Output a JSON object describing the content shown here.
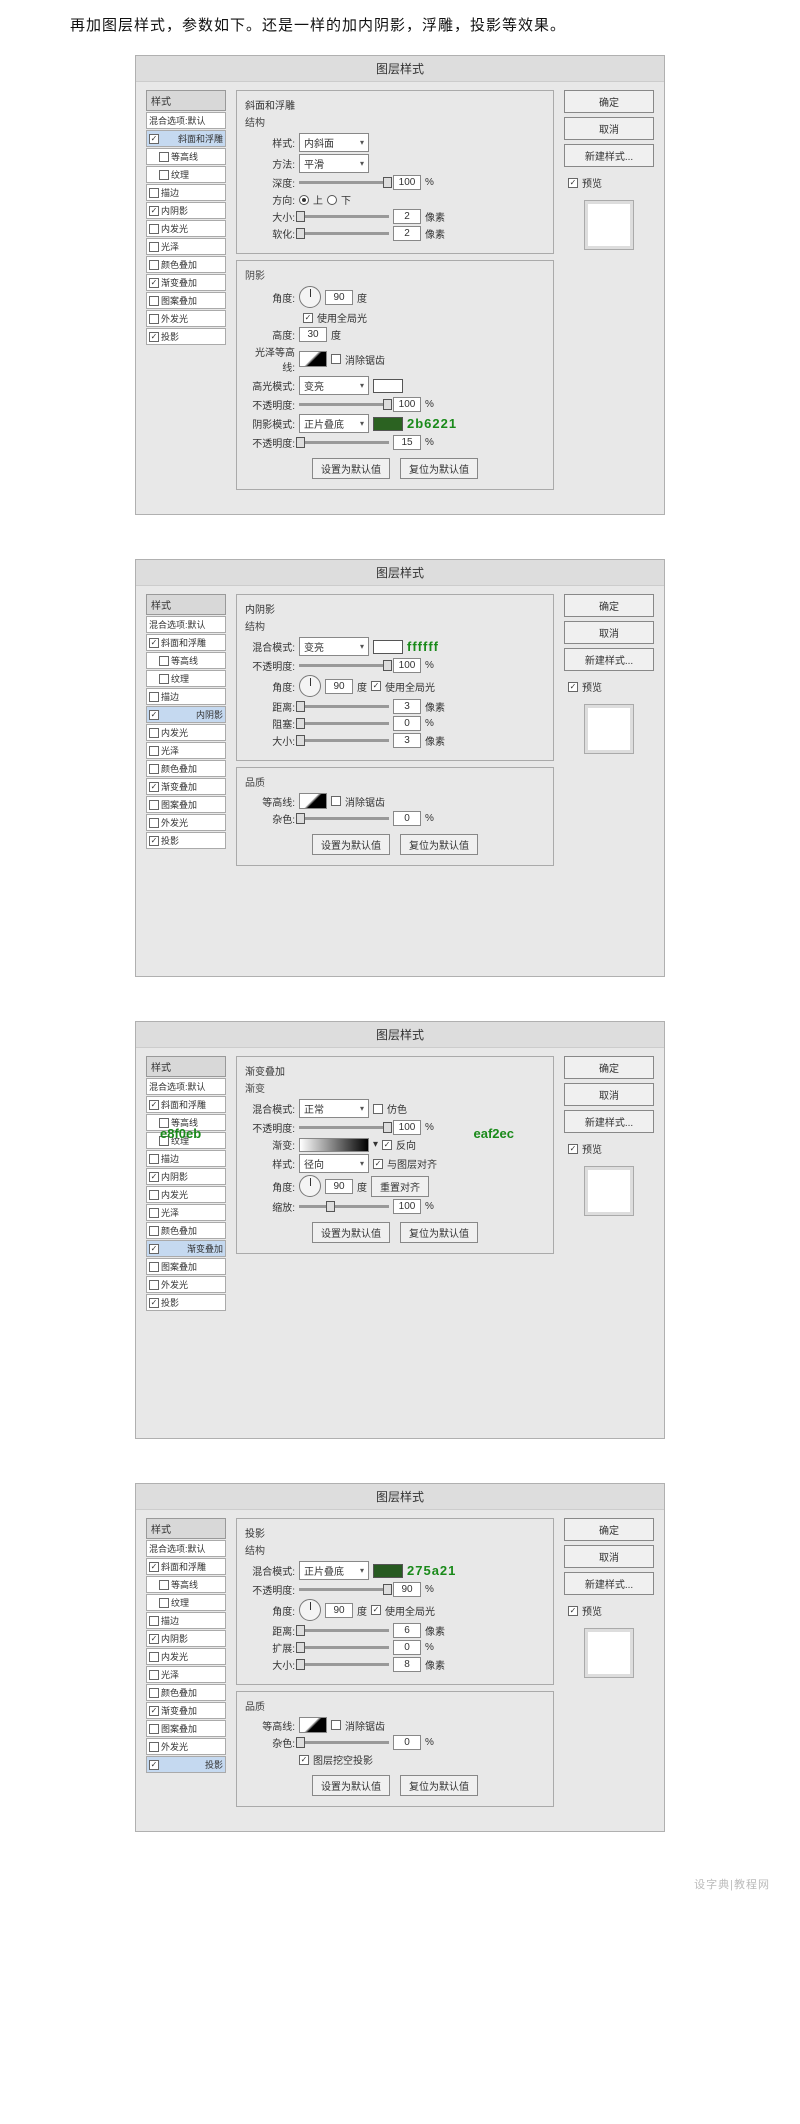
{
  "intro_text": "再加图层样式，参数如下。还是一样的加内阴影，浮雕，投影等效果。",
  "common": {
    "dialog_title": "图层样式",
    "ok": "确定",
    "cancel": "取消",
    "new_style": "新建样式...",
    "preview": "预览",
    "set_default": "设置为默认值",
    "reset_default": "复位为默认值",
    "styles_header": "样式",
    "blend_default": "混合选项:默认"
  },
  "style_names": {
    "bevel": "斜面和浮雕",
    "contour": "等高线",
    "texture": "纹理",
    "stroke": "描边",
    "inner_shadow": "内阴影",
    "inner_glow": "内发光",
    "satin": "光泽",
    "color_overlay": "颜色叠加",
    "gradient_overlay": "渐变叠加",
    "pattern_overlay": "图案叠加",
    "outer_glow": "外发光",
    "drop_shadow": "投影"
  },
  "panel1": {
    "title": "斜面和浮雕",
    "struct": "结构",
    "style_lbl": "样式:",
    "style_val": "内斜面",
    "method_lbl": "方法:",
    "method_val": "平滑",
    "depth_lbl": "深度:",
    "depth_val": "100",
    "pct": "%",
    "dir_lbl": "方向:",
    "up": "上",
    "down": "下",
    "size_lbl": "大小:",
    "size_val": "2",
    "px": "像素",
    "soft_lbl": "软化:",
    "soft_val": "2",
    "shade": "阴影",
    "angle_lbl": "角度:",
    "angle_val": "90",
    "deg": "度",
    "global": "使用全局光",
    "alt_lbl": "高度:",
    "alt_val": "30",
    "gloss_lbl": "光泽等高线:",
    "anti": "消除锯齿",
    "hi_mode_lbl": "高光模式:",
    "hi_mode_val": "变亮",
    "opacity_lbl": "不透明度:",
    "hi_op_val": "100",
    "sh_mode_lbl": "阴影模式:",
    "sh_mode_val": "正片叠底",
    "sh_op_val": "15",
    "color_label": "2b6221"
  },
  "panel2": {
    "title": "内阴影",
    "struct": "结构",
    "blend_lbl": "混合模式:",
    "blend_val": "变亮",
    "color_label": "ffffff",
    "opacity_lbl": "不透明度:",
    "opacity_val": "100",
    "pct": "%",
    "angle_lbl": "角度:",
    "angle_val": "90",
    "deg": "度",
    "global": "使用全局光",
    "dist_lbl": "距离:",
    "dist_val": "3",
    "px": "像素",
    "choke_lbl": "阻塞:",
    "choke_val": "0",
    "size_lbl": "大小:",
    "size_val": "3",
    "quality": "品质",
    "contour_lbl": "等高线:",
    "anti": "消除锯齿",
    "noise_lbl": "杂色:",
    "noise_val": "0"
  },
  "panel3": {
    "title": "渐变叠加",
    "grad": "渐变",
    "blend_lbl": "混合模式:",
    "blend_val": "正常",
    "dither": "仿色",
    "opacity_lbl": "不透明度:",
    "opacity_val": "100",
    "pct": "%",
    "grad_lbl": "渐变:",
    "reverse": "反向",
    "style_lbl": "样式:",
    "style_val": "径向",
    "align": "与图层对齐",
    "angle_lbl": "角度:",
    "angle_val": "90",
    "deg": "度",
    "reset_align": "重置对齐",
    "scale_lbl": "缩放:",
    "scale_val": "100",
    "annot_left": "e8f0eb",
    "annot_right": "eaf2ec"
  },
  "panel4": {
    "title": "投影",
    "struct": "结构",
    "blend_lbl": "混合模式:",
    "blend_val": "正片叠底",
    "color_label": "275a21",
    "opacity_lbl": "不透明度:",
    "opacity_val": "90",
    "pct": "%",
    "angle_lbl": "角度:",
    "angle_val": "90",
    "deg": "度",
    "global": "使用全局光",
    "dist_lbl": "距离:",
    "dist_val": "6",
    "px": "像素",
    "spread_lbl": "扩展:",
    "spread_val": "0",
    "size_lbl": "大小:",
    "size_val": "8",
    "quality": "品质",
    "contour_lbl": "等高线:",
    "anti": "消除锯齿",
    "noise_lbl": "杂色:",
    "noise_val": "0",
    "knockout": "图层挖空投影"
  },
  "watermark": "设字典|教程网"
}
